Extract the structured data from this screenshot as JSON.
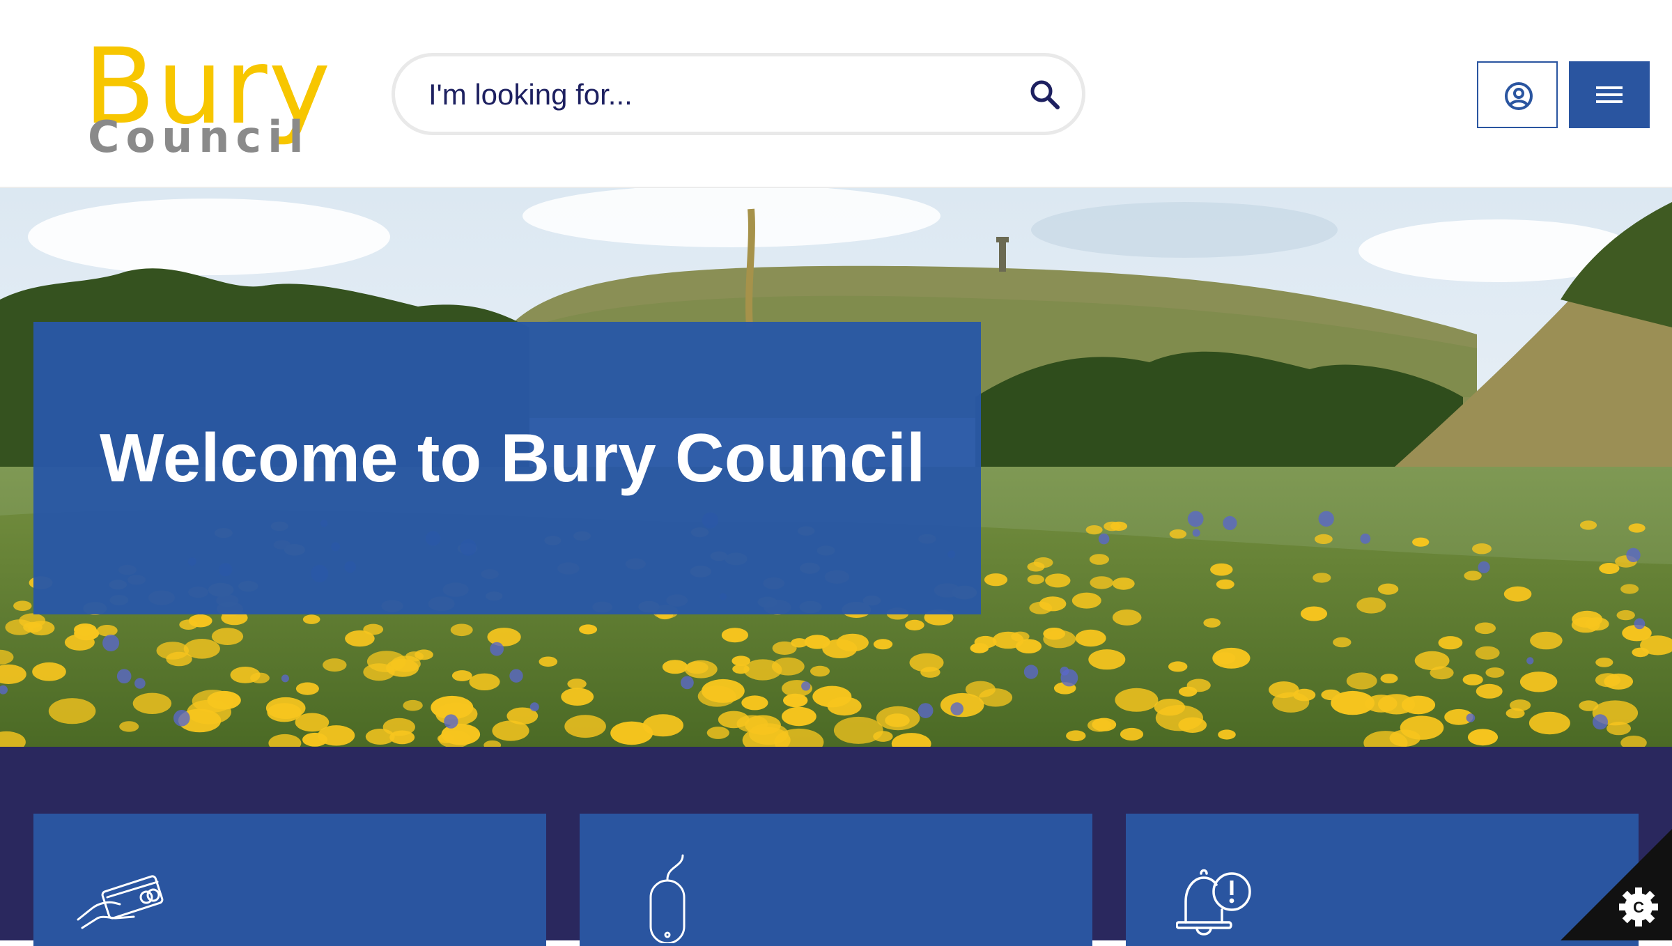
{
  "header": {
    "logo": {
      "line1": "Bury",
      "line2": "Council"
    },
    "search": {
      "placeholder": "I'm looking for..."
    },
    "icons": {
      "search": "search-icon",
      "account": "user-circle-icon",
      "menu": "hamburger-menu-icon"
    }
  },
  "hero": {
    "title": "Welcome to Bury Council"
  },
  "cards": [
    {
      "icon": "hand-holding-card-icon"
    },
    {
      "icon": "computer-mouse-icon"
    },
    {
      "icon": "bell-alert-icon"
    }
  ],
  "cookie": {
    "icon": "cookie-settings-gear-icon"
  },
  "colors": {
    "brand_blue": "#2a55a0",
    "brand_yellow": "#f7c600",
    "navy_band": "#2a285e",
    "logo_gray": "#8a8a8a",
    "text_navy": "#1d2060"
  }
}
